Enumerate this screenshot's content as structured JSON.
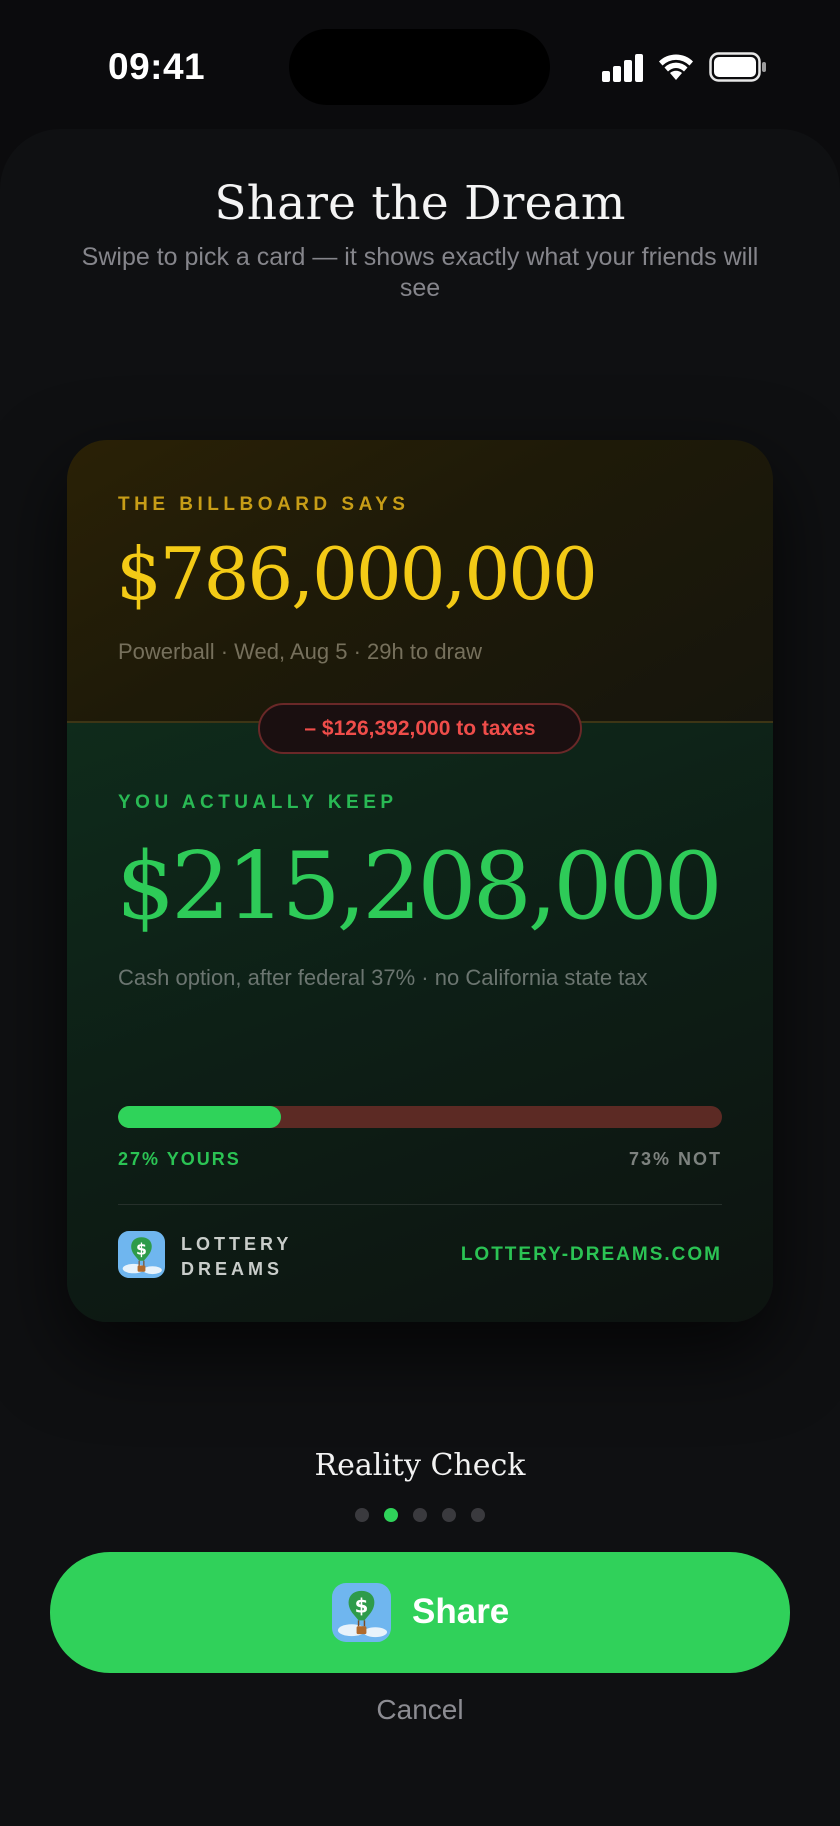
{
  "status_bar": {
    "time": "09:41"
  },
  "sheet": {
    "title": "Share the Dream",
    "subtitle": "Swipe to pick a card — it shows exactly what your friends will see"
  },
  "card": {
    "billboard_label": "THE BILLBOARD SAYS",
    "billboard_amount": "$786,000,000",
    "billboard_meta": "Powerball · Wed, Aug 5 · 29h to draw",
    "tax_pill": "– $126,392,000 to taxes",
    "keep_label": "YOU ACTUALLY KEEP",
    "keep_amount": "$215,208,000",
    "keep_meta": "Cash option, after federal 37% · no California state tax",
    "yours_fraction": 0.27,
    "yours_label": "27% YOURS",
    "not_label": "73% NOT",
    "brand_line1": "LOTTERY",
    "brand_line2": "DREAMS",
    "brand_url": "LOTTERY-DREAMS.COM",
    "brand_icon": "money-balloon-icon"
  },
  "carousel": {
    "card_name": "Reality Check",
    "page_count": 5,
    "active_index": 1
  },
  "actions": {
    "share_label": "Share",
    "share_icon": "money-balloon-icon",
    "cancel_label": "Cancel"
  },
  "colors": {
    "accent_green": "#30d15a",
    "gold": "#f3ca16",
    "tax_red": "#ef4d4a"
  }
}
